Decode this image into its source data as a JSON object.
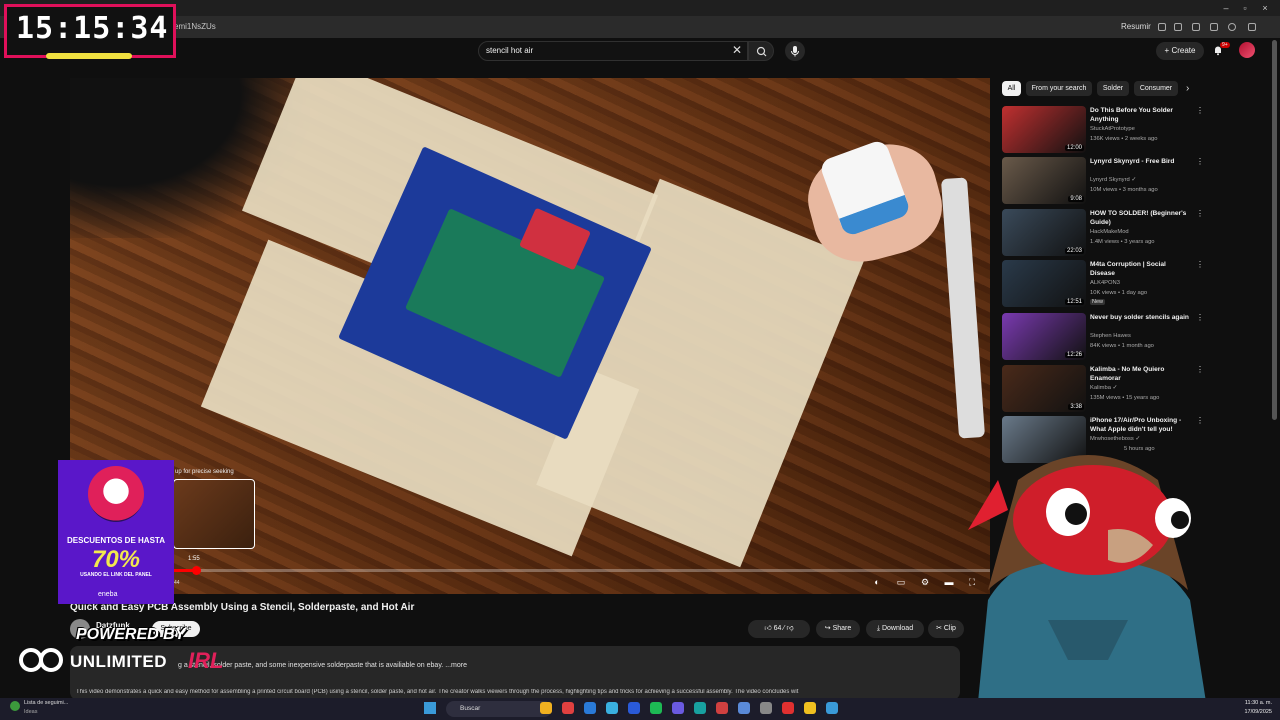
{
  "browser": {
    "url_fragment": "emi1NsZUs",
    "resumir_label": "Resumir"
  },
  "header": {
    "search_query": "stencil hot air",
    "create_label": "Create",
    "notification_count": "9+"
  },
  "player": {
    "seek_hint": "up for precise seeking",
    "seek_time": "1:55",
    "time_readout": "44",
    "progress_fraction": 0.137
  },
  "video": {
    "title": "Quick and Easy PCB Assembly Using a Stencil, Solderpaste, and Hot Air",
    "channel": "Datzfunk",
    "subscribe_label": "Subscribe",
    "likes": "64",
    "share_label": "Share",
    "download_label": "Download",
    "clip_label": "Clip",
    "desc_line1": "g a stencil, solder paste, and some inexpensive solderpaste that is availiable on ebay. ...more",
    "desc_line2": "This video demonstrates a quick and easy method for assembling a printed circuit board (PCB) using a stencil, solder paste, and hot air. The creator walks viewers through the process, highlighting tips and tricks for achieving a successful assembly. The video concludes wit"
  },
  "chips": [
    "All",
    "From your search",
    "Solder",
    "Consumer"
  ],
  "recommendations": [
    {
      "title": "Do This Before You Solder Anything",
      "channel": "StuckAtPrototype",
      "meta": "136K views • 2 weeks ago",
      "duration": "12:00",
      "thumb": "#c03030"
    },
    {
      "title": "Lynyrd Skynyrd - Free Bird",
      "channel": "Lynyrd Skynyrd ✓",
      "meta": "10M views • 3 months ago",
      "duration": "9:08",
      "thumb": "#6a5a4a"
    },
    {
      "title": "HOW TO SOLDER! (Beginner's Guide)",
      "channel": "HackMakeMod",
      "meta": "1.4M views • 3 years ago",
      "duration": "22:03",
      "thumb": "#3a4a5a"
    },
    {
      "title": "M4ta Corruption | Social Disease",
      "channel": "ALK4PON3",
      "meta": "10K views • 1 day ago",
      "badge": "New",
      "duration": "12:51",
      "thumb": "#2a3a4a"
    },
    {
      "title": "Never buy solder stencils again",
      "channel": "Stephen Hawes",
      "meta": "84K views • 1 month ago",
      "duration": "12:26",
      "thumb": "#7a3ab0"
    },
    {
      "title": "Kalimba - No Me Quiero Enamorar",
      "channel": "Kalimba ✓",
      "meta": "135M views • 15 years ago",
      "duration": "3:38",
      "thumb": "#4a2a1a"
    },
    {
      "title": "iPhone 17/Air/Pro Unboxing - What Apple didn't tell you!",
      "channel": "Mrwhosetheboss ✓",
      "meta": "",
      "partial_meta": "5 hours ago",
      "duration": "",
      "thumb": "#6a7a8a"
    }
  ],
  "overlay": {
    "clock": "15:15:34",
    "promo_l1": "DESCUENTOS DE HASTA",
    "promo_l2": "70%",
    "promo_l3": "USANDO EL LINK DEL PANEL",
    "promo_brand": "eneba",
    "powered_l1": "POWERED BY",
    "powered_l2": "UNLIMITED",
    "powered_l3": "IRL"
  },
  "taskbar": {
    "news1": "Lista de seguimi...",
    "news2": "Ideas",
    "search": "Buscar",
    "time": "11:30 a. m.",
    "date": "17/09/2025"
  },
  "colors": {
    "accent": "#ff0000",
    "clock_border": "#e0105a",
    "promo_bg": "#5a17c9"
  }
}
